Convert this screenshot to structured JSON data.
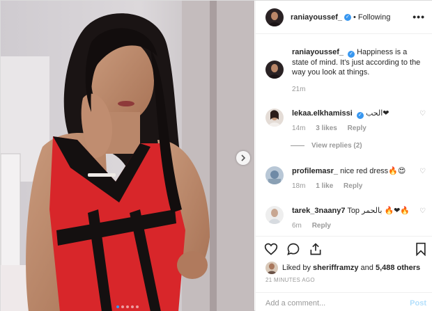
{
  "post": {
    "image_alt": "Woman in red and black dress",
    "carousel_count": 5,
    "carousel_active": 0
  },
  "header": {
    "username": "raniayoussef_",
    "separator": "•",
    "follow_label": "Following",
    "more_label": "•••"
  },
  "caption": {
    "username": "raniayoussef_",
    "text": "Happiness is a state of mind. It's just according to the way you look at things.",
    "time": "21m"
  },
  "comments": [
    {
      "username": "lekaa.elkhamissi",
      "verified": true,
      "text": "الحب❤",
      "time": "14m",
      "likes": "3 likes",
      "reply": "Reply"
    },
    {
      "username": "profilemasr_",
      "verified": false,
      "text": "nice red dress🔥😍",
      "time": "18m",
      "likes": "1 like",
      "reply": "Reply"
    },
    {
      "username": "tarek_3naany7",
      "verified": false,
      "text": "Top بالحمر 🔥❤🔥",
      "time": "6m",
      "likes": "",
      "reply": "Reply"
    }
  ],
  "view_replies": "View replies (2)",
  "likes": {
    "prefix": "Liked by",
    "user": "sherifframzy",
    "and": "and",
    "others": "5,488 others"
  },
  "timestamp": "21 MINUTES AGO",
  "add_comment": {
    "placeholder": "Add a comment...",
    "post_label": "Post"
  },
  "colors": {
    "verified": "#3897f0",
    "post_disabled": "#b2dffc",
    "meta": "#999999"
  }
}
